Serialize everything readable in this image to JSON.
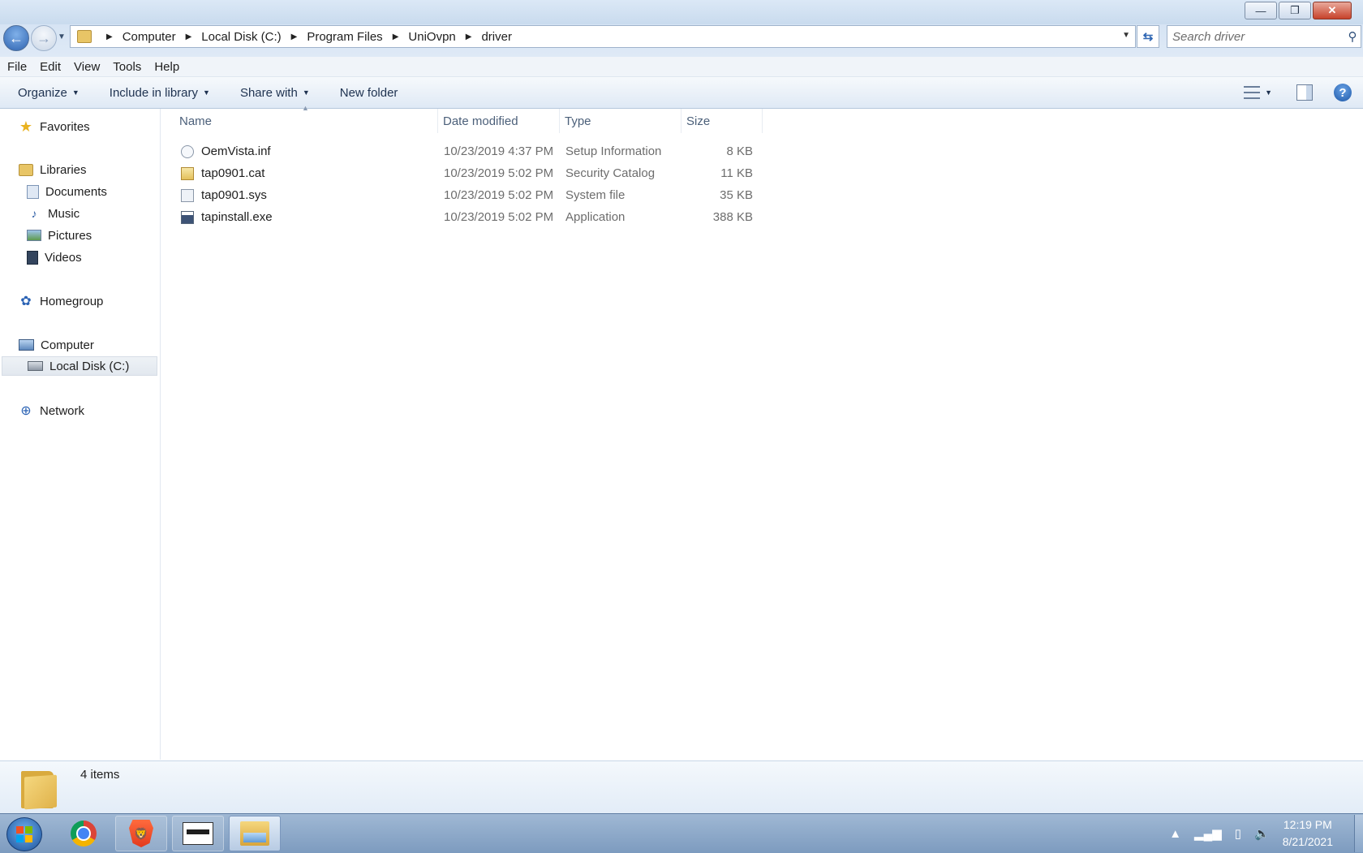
{
  "window": {
    "minimize_glyph": "—",
    "maximize_glyph": "❐",
    "close_glyph": "✕"
  },
  "address": {
    "breadcrumbs": [
      "Computer",
      "Local Disk (C:)",
      "Program Files",
      "UniOvpn",
      "driver"
    ],
    "search_placeholder": "Search driver"
  },
  "menu": [
    "File",
    "Edit",
    "View",
    "Tools",
    "Help"
  ],
  "commands": {
    "organize": "Organize",
    "include_in_library": "Include in library",
    "share_with": "Share with",
    "new_folder": "New folder"
  },
  "nav": {
    "favorites": "Favorites",
    "libraries": "Libraries",
    "documents": "Documents",
    "music": "Music",
    "pictures": "Pictures",
    "videos": "Videos",
    "homegroup": "Homegroup",
    "computer": "Computer",
    "local_disk": "Local Disk (C:)",
    "network": "Network"
  },
  "columns": {
    "name": "Name",
    "date_modified": "Date modified",
    "type": "Type",
    "size": "Size"
  },
  "files": [
    {
      "name": "OemVista.inf",
      "date": "10/23/2019 4:37 PM",
      "type": "Setup Information",
      "size": "8 KB",
      "icon": "setup-information-icon"
    },
    {
      "name": "tap0901.cat",
      "date": "10/23/2019 5:02 PM",
      "type": "Security Catalog",
      "size": "11 KB",
      "icon": "security-catalog-icon"
    },
    {
      "name": "tap0901.sys",
      "date": "10/23/2019 5:02 PM",
      "type": "System file",
      "size": "35 KB",
      "icon": "system-file-icon"
    },
    {
      "name": "tapinstall.exe",
      "date": "10/23/2019 5:02 PM",
      "type": "Application",
      "size": "388 KB",
      "icon": "application-icon"
    }
  ],
  "status": {
    "item_count": "4 items"
  },
  "taskbar": {
    "time": "12:19 PM",
    "date": "8/21/2021"
  },
  "colors": {
    "accent": "#2e63b0",
    "window_frame": "#c9dbee",
    "taskbar": "#7d9bbf"
  }
}
